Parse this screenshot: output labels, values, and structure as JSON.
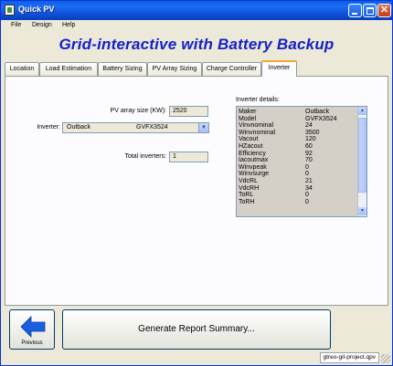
{
  "window": {
    "title": "Quick PV"
  },
  "menu": [
    "File",
    "Design",
    "Help"
  ],
  "banner": "Grid-interactive with Battery Backup",
  "tabs": [
    {
      "label": "Location",
      "active": false
    },
    {
      "label": "Load Estimation",
      "active": false
    },
    {
      "label": "Battery Sizing",
      "active": false
    },
    {
      "label": "PV Array Sizing",
      "active": false
    },
    {
      "label": "Charge Controller",
      "active": false
    },
    {
      "label": "Inverter",
      "active": true
    }
  ],
  "inverter_tab": {
    "pv_array_label": "PV array size (KW):",
    "pv_array_value": "2520",
    "inverter_label": "Inverter:",
    "inverter_maker": "Outback",
    "inverter_model": "GVFX3524",
    "total_label": "Total inverters:",
    "total_value": "1",
    "details_title": "Inverter details:",
    "details": [
      {
        "key": "Maker",
        "value": "Outback"
      },
      {
        "key": "Model",
        "value": "GVFX3524"
      },
      {
        "key": "Vinvnominal",
        "value": "24"
      },
      {
        "key": "Winvnominal",
        "value": "3500"
      },
      {
        "key": "Vacout",
        "value": "120"
      },
      {
        "key": "HZacout",
        "value": "60"
      },
      {
        "key": "Efficiency",
        "value": "92"
      },
      {
        "key": "Iacoutmax",
        "value": "70"
      },
      {
        "key": "Winvpeak",
        "value": "0"
      },
      {
        "key": "Winvsurge",
        "value": "0"
      },
      {
        "key": "VdcRL",
        "value": "21"
      },
      {
        "key": "VdcRH",
        "value": "34"
      },
      {
        "key": "ToRL",
        "value": "0"
      },
      {
        "key": "ToRH",
        "value": "0"
      }
    ]
  },
  "footer": {
    "previous_label": "Previous",
    "generate_label": "Generate Report Summary..."
  },
  "status": {
    "file": "gtreo-gil-project.qpv"
  },
  "colors": {
    "banner": "#1420c8",
    "titlebar": "#0a5fe8",
    "arrow": "#1a5ee0"
  }
}
